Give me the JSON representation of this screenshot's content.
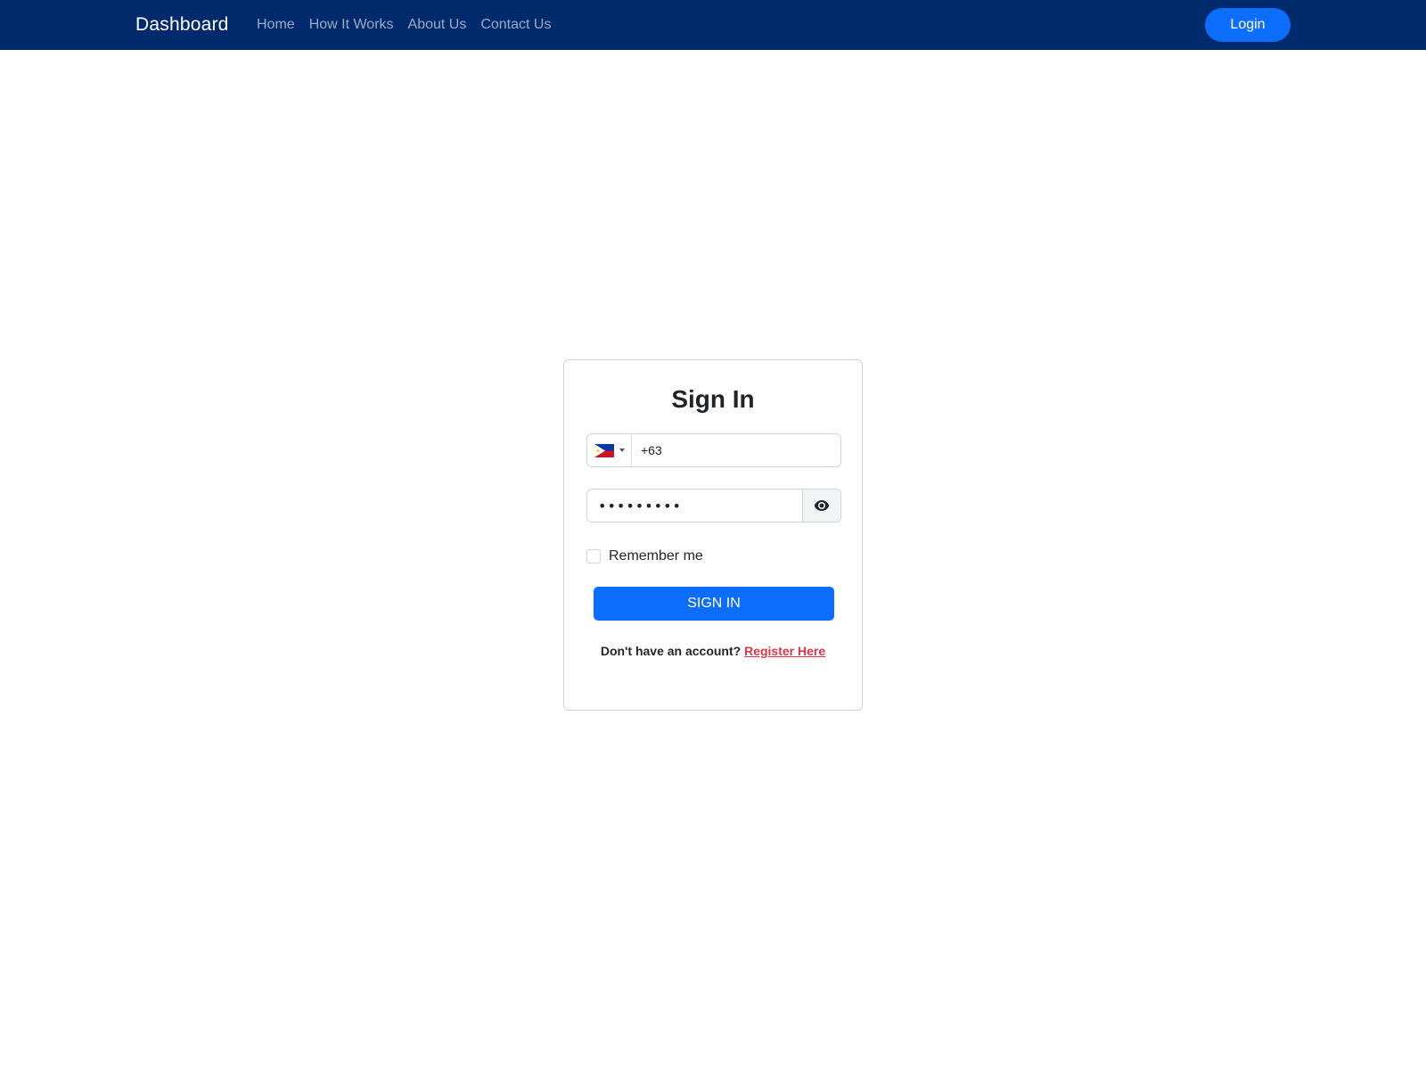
{
  "navbar": {
    "brand": "Dashboard",
    "links": [
      {
        "label": "Home"
      },
      {
        "label": "How It Works"
      },
      {
        "label": "About Us"
      },
      {
        "label": "Contact Us"
      }
    ],
    "login_label": "Login",
    "background_color": "#002a6c",
    "login_color": "#0d6efd"
  },
  "signin_card": {
    "title": "Sign In",
    "phone": {
      "country_flag": "philippines-flag-icon",
      "value": "+63"
    },
    "password": {
      "value": "•••••••••",
      "toggle_icon": "eye-icon"
    },
    "remember_label": "Remember me",
    "submit_label": "SIGN IN",
    "submit_color": "#0d6efd",
    "register_prompt": "Don't have an account?",
    "register_link": "Register Here",
    "register_link_color": "#dc3545"
  }
}
